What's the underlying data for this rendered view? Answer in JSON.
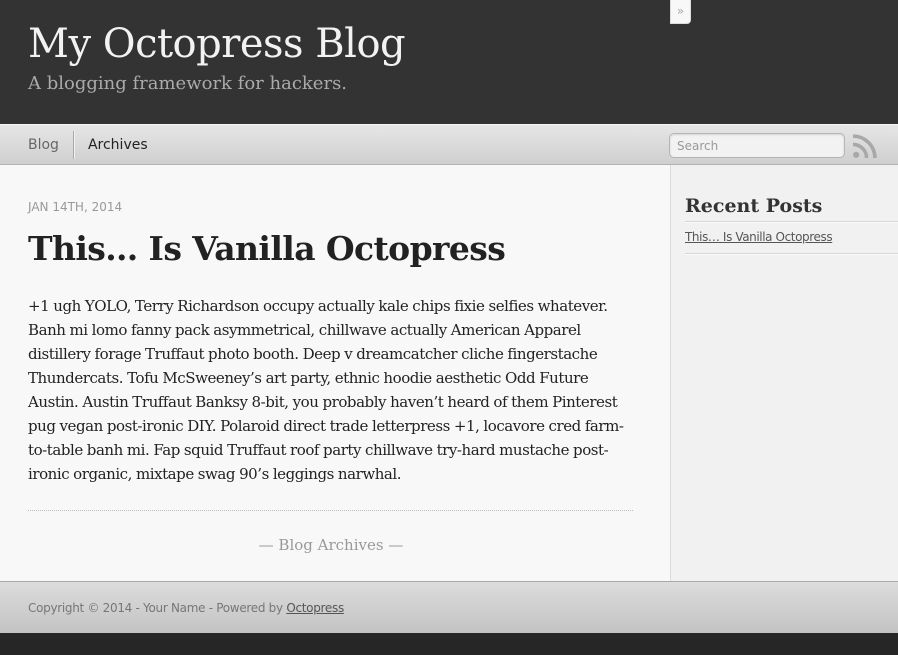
{
  "header": {
    "title": "My Octopress Blog",
    "subtitle": "A blogging framework for hackers."
  },
  "nav": {
    "links": [
      {
        "label": "Blog"
      },
      {
        "label": "Archives"
      }
    ],
    "search": {
      "placeholder": "Search",
      "value": ""
    },
    "rss_icon": "rss-icon"
  },
  "post": {
    "date": "Jan 14th, 2014",
    "title": "This… Is Vanilla Octopress",
    "body": "+1 ugh YOLO, Terry Richardson occupy actually kale chips fixie selfies whatever. Banh mi lomo fanny pack asymmetrical, chillwave actually American Apparel distillery forage Truffaut photo booth. Deep v dreamcatcher cliche fingerstache Thundercats. Tofu McSweeney’s art party, ethnic hoodie aesthetic Odd Future Austin. Austin Truffaut Banksy 8-bit, you probably haven’t heard of them Pinterest pug vegan post-ironic DIY. Polaroid direct trade letterpress +1, locavore cred farm-to-table banh mi. Fap squid Truffaut roof party chillwave try-hard mustache post-ironic organic, mixtape swag 90’s leggings narwhal."
  },
  "archives_link": "— Blog Archives —",
  "sidebar": {
    "toggle": "»",
    "heading": "Recent Posts",
    "posts": [
      {
        "title": "This… Is Vanilla Octopress"
      }
    ]
  },
  "footer": {
    "text": "Copyright © 2014 - Your Name - Powered by ",
    "link": "Octopress"
  },
  "colors": {
    "header_bg": "#333333",
    "content_bg": "#f8f8f8",
    "sidebar_bg": "#f1f1f1",
    "rss_orange_muted": "#9a9a9a"
  }
}
